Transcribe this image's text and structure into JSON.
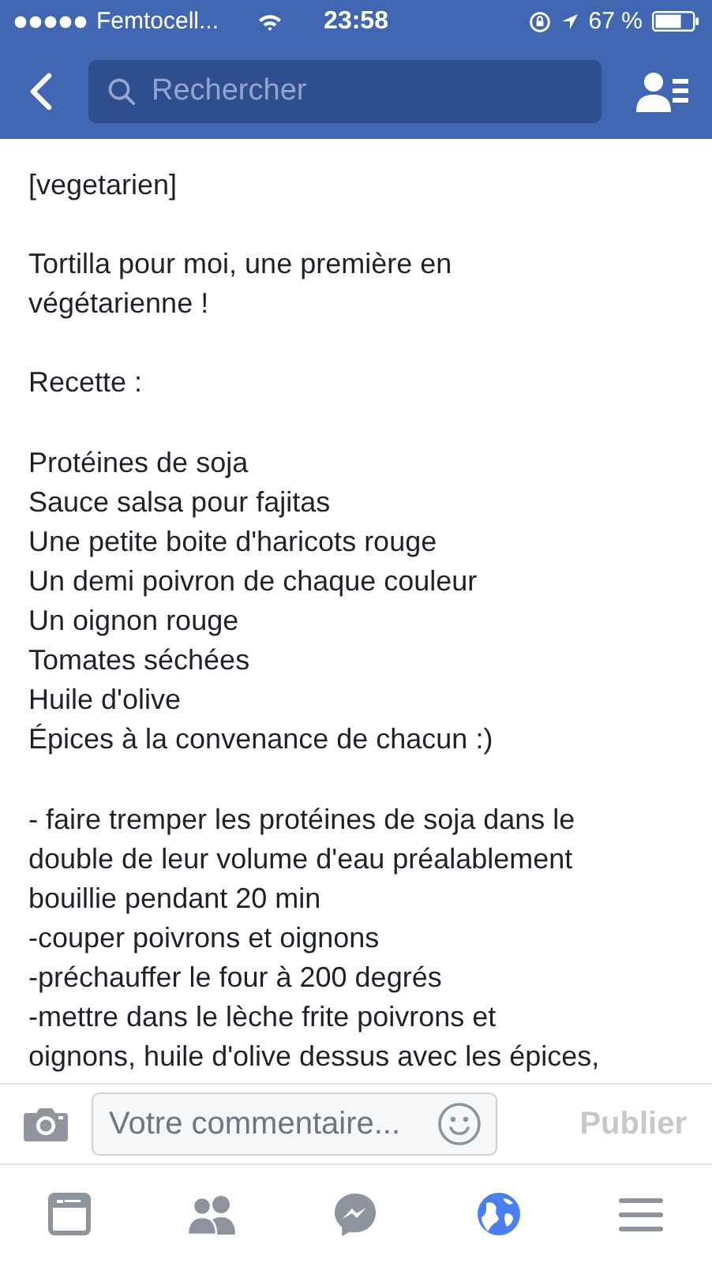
{
  "status_bar": {
    "carrier": "Femtocell...",
    "time": "23:58",
    "battery": "67 %"
  },
  "nav": {
    "search": {
      "placeholder": "Rechercher"
    }
  },
  "post": {
    "paragraphs": [
      [
        "[vegetarien]"
      ],
      [
        "Tortilla pour moi, une première en",
        "végétarienne !"
      ],
      [
        "Recette :"
      ],
      [
        "Protéines de soja",
        "Sauce salsa pour fajitas",
        "Une petite boite d'haricots rouge",
        "Un demi poivron de chaque couleur",
        "Un oignon rouge",
        "Tomates séchées",
        "Huile d'olive",
        "Épices à la convenance de chacun :)"
      ],
      [
        "- faire tremper les protéines de soja dans le",
        "double de leur volume d'eau préalablement",
        "bouillie pendant 20 min",
        "-couper poivrons et oignons",
        "-préchauffer le four à 200 degrés",
        "-mettre dans le lèche frite poivrons et",
        "oignons, huile d'olive dessus avec les épices,"
      ]
    ]
  },
  "comment": {
    "placeholder": "Votre commentaire...",
    "publish": {
      "label": "Publier",
      "disabled": true
    }
  },
  "tab_bar": [
    {
      "kind": "feed",
      "selected": false
    },
    {
      "kind": "friends",
      "selected": false
    },
    {
      "kind": "messenger",
      "selected": false
    },
    {
      "kind": "globe",
      "selected": true
    },
    {
      "kind": "menu",
      "selected": false
    }
  ]
}
